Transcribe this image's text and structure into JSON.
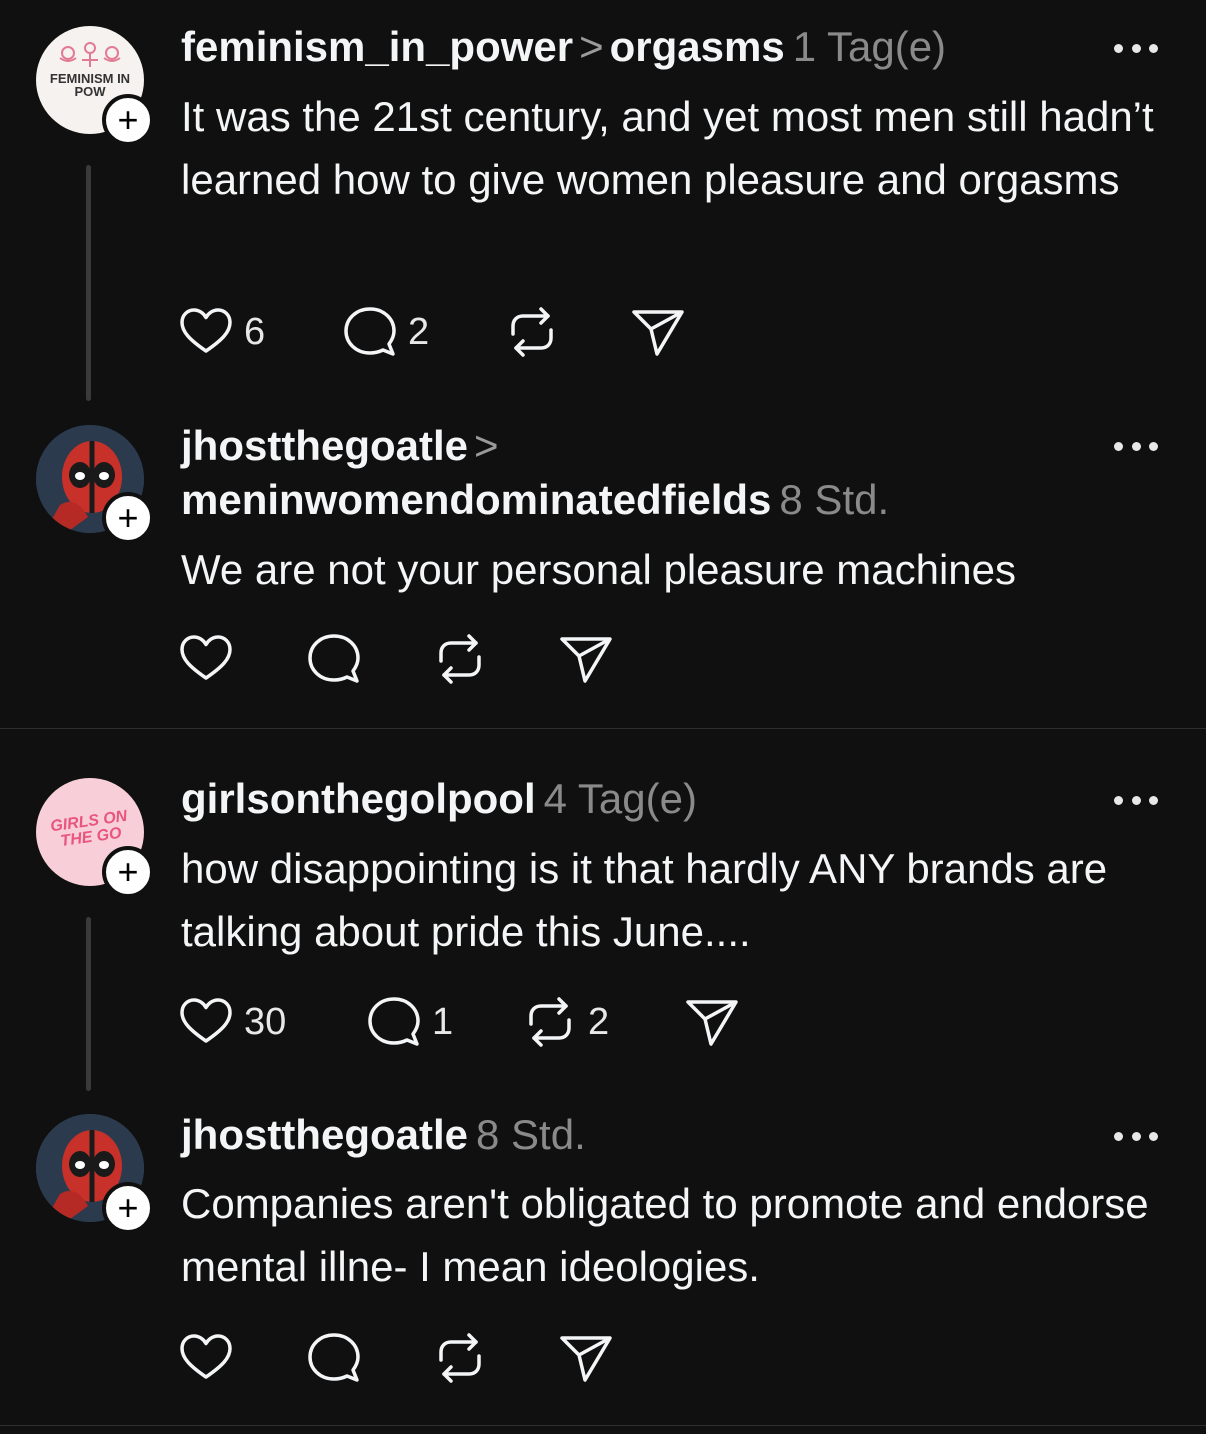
{
  "threads": [
    {
      "post": {
        "username": "feminism_in_power",
        "reply_to": "orgasms",
        "time": "1 Tag(e)",
        "text": "It was the 21st century, and yet most men still hadn’t learned how to give women pleasure and orgasms",
        "avatar_text": "FEMINISM IN POW",
        "likes": "6",
        "comments": "2"
      },
      "reply": {
        "username": "jhostthegoatle",
        "reply_to": "meninwomendominatedfields",
        "time": "8 Std.",
        "text": "We are not your personal pleasure machines"
      }
    },
    {
      "post": {
        "username": "girlsonthegolpool",
        "time": "4 Tag(e)",
        "text": "how disappointing is it that hardly ANY brands are talking about pride this June....",
        "avatar_text": "GIRLS ON THE GO",
        "likes": "30",
        "comments": "1",
        "reposts": "2"
      },
      "reply": {
        "username": "jhostthegoatle",
        "time": "8 Std.",
        "text": "Companies aren't obligated to promote and endorse mental illne- I mean ideologies."
      }
    }
  ],
  "icons": {
    "like": "heart-icon",
    "comment": "comment-icon",
    "repost": "repost-icon",
    "share": "share-icon",
    "more": "more-icon",
    "follow": "plus-icon"
  },
  "colors": {
    "background": "#101010",
    "text": "#f3f5f7",
    "muted": "#8a8a8a",
    "thread_line": "#3a3a3a"
  },
  "follow_label": "+",
  "chevron": ">"
}
